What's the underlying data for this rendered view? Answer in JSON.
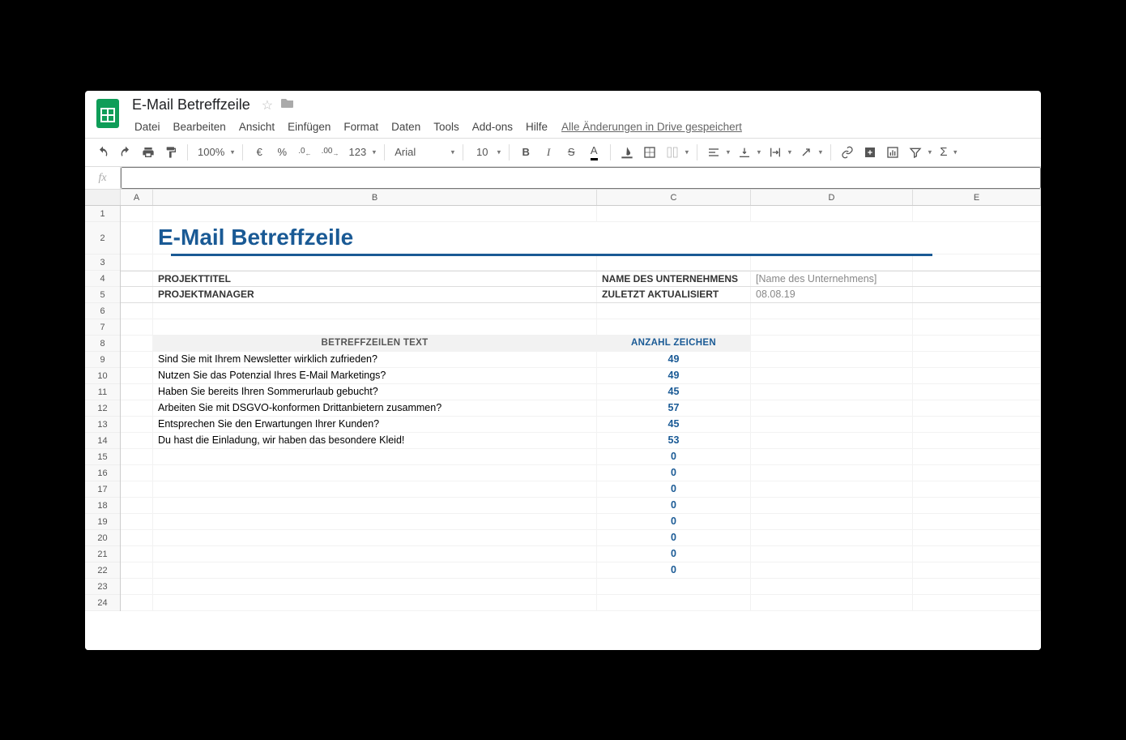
{
  "doc_title": "E-Mail Betreffzeile",
  "menu": {
    "datei": "Datei",
    "bearbeiten": "Bearbeiten",
    "ansicht": "Ansicht",
    "einfuegen": "Einfügen",
    "format": "Format",
    "daten": "Daten",
    "tools": "Tools",
    "addons": "Add-ons",
    "hilfe": "Hilfe",
    "drive_status": "Alle Änderungen in Drive gespeichert"
  },
  "toolbar": {
    "zoom": "100%",
    "currency": "€",
    "percent": "%",
    "dec_dec": ".0",
    "dec_inc": ".00",
    "num_format": "123",
    "font": "Arial",
    "font_size": "10",
    "bold": "B",
    "italic": "I",
    "strike": "S",
    "text_color": "A",
    "sigma": "Σ"
  },
  "formula_bar": {
    "fx": "fx",
    "value": ""
  },
  "columns": [
    "A",
    "B",
    "C",
    "D",
    "E"
  ],
  "row_numbers": [
    "1",
    "2",
    "3",
    "4",
    "5",
    "6",
    "7",
    "8",
    "9",
    "10",
    "11",
    "12",
    "13",
    "14",
    "15",
    "16",
    "17",
    "18",
    "19",
    "20",
    "21",
    "22",
    "23",
    "24"
  ],
  "sheet": {
    "title": "E-Mail Betreffzeile",
    "projekttitel_label": "PROJEKTTITEL",
    "projektmanager_label": "PROJEKTMANAGER",
    "company_label": "NAME DES UNTERNEHMENS",
    "company_value": "[Name des Unternehmens]",
    "updated_label": "ZULETZT AKTUALISIERT",
    "updated_value": "08.08.19",
    "col_subject": "BETREFFZEILEN TEXT",
    "col_count": "ANZAHL ZEICHEN",
    "rows": [
      {
        "text": "Sind Sie mit Ihrem Newsletter wirklich zufrieden?",
        "count": "49"
      },
      {
        "text": "Nutzen Sie das Potenzial Ihres E-Mail Marketings?",
        "count": "49"
      },
      {
        "text": "Haben Sie bereits Ihren Sommerurlaub gebucht?",
        "count": "45"
      },
      {
        "text": "Arbeiten Sie mit DSGVO-konformen Drittanbietern zusammen?",
        "count": "57"
      },
      {
        "text": "Entsprechen Sie den Erwartungen Ihrer Kunden?",
        "count": "45"
      },
      {
        "text": "Du hast die Einladung, wir haben das besondere Kleid!",
        "count": "53"
      },
      {
        "text": "",
        "count": "0"
      },
      {
        "text": "",
        "count": "0"
      },
      {
        "text": "",
        "count": "0"
      },
      {
        "text": "",
        "count": "0"
      },
      {
        "text": "",
        "count": "0"
      },
      {
        "text": "",
        "count": "0"
      },
      {
        "text": "",
        "count": "0"
      },
      {
        "text": "",
        "count": "0"
      }
    ]
  }
}
